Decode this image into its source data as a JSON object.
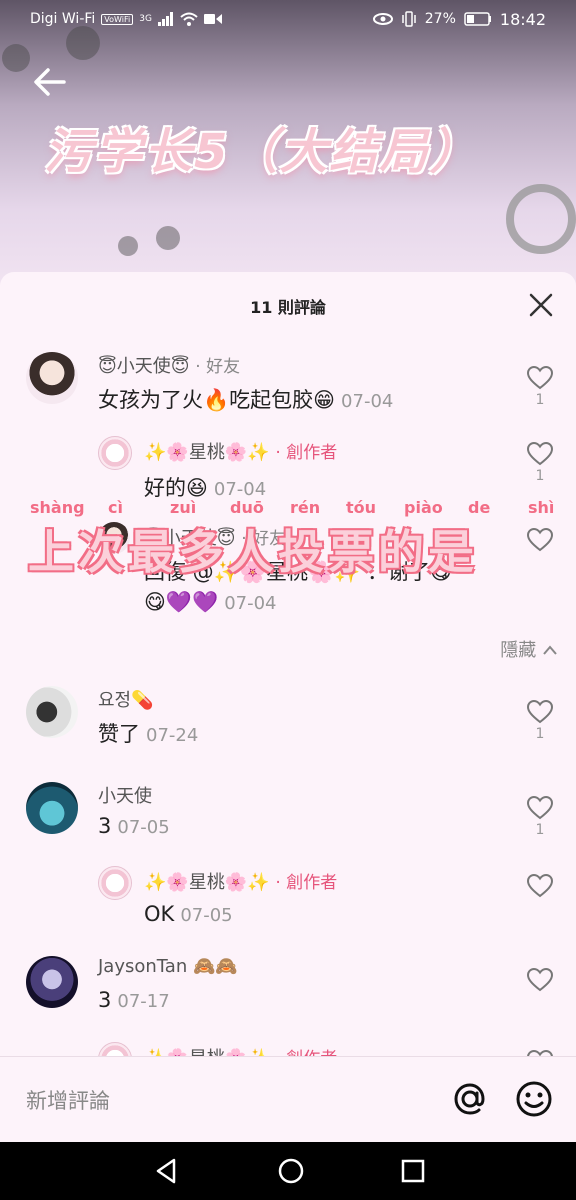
{
  "status_bar": {
    "carrier": "Digi Wi-Fi",
    "volte": "VoWiFi",
    "network": "3G",
    "battery": "27%",
    "time": "18:42"
  },
  "video": {
    "title": "污学长5（大结局）"
  },
  "comments_panel": {
    "count_title": "11 則評論",
    "hide_label": "隱藏",
    "comments": [
      {
        "user": "😇小天使😇",
        "badge": "· 好友",
        "text": "女孩为了火🔥吃起包胶😁",
        "date": "07-04",
        "likes": "1"
      },
      {
        "user": "✨🌸星桃🌸✨",
        "badge": "· 創作者",
        "text": "好的😆",
        "date": "07-04",
        "likes": "1"
      },
      {
        "user": "😇小天使😇",
        "badge": "· 好友",
        "text": "回復 @✨🌸星桃🌸✨ ：谢了😋",
        "text2": "😋💜💜",
        "date": "07-04"
      },
      {
        "user": "요정💊",
        "badge": "",
        "text": "赞了",
        "date": "07-24",
        "likes": "1"
      },
      {
        "user": "小天使",
        "badge": "",
        "text": "3",
        "date": "07-05",
        "likes": "1"
      },
      {
        "user": "✨🌸星桃🌸✨",
        "badge": "· 創作者",
        "text": "OK",
        "date": "07-05"
      },
      {
        "user": "JaysonTan 🙈🙈",
        "badge": "",
        "text": "3",
        "date": "07-17"
      },
      {
        "user": "✨🌸星桃🌸✨",
        "badge": "· 創作者",
        "text": "",
        "date": ""
      }
    ]
  },
  "overlay": {
    "pinyin": [
      "shàng",
      "cì",
      "zuì",
      "duō",
      "rén",
      "tóu",
      "piào",
      "de",
      "shì"
    ],
    "hanzi": "上次最多人投票的是"
  },
  "input": {
    "placeholder": "新增評論"
  },
  "colors": {
    "panel_bg": "#fdf3fa",
    "creator_tag": "#e6547b",
    "overlay_pink": "#f26d86"
  }
}
